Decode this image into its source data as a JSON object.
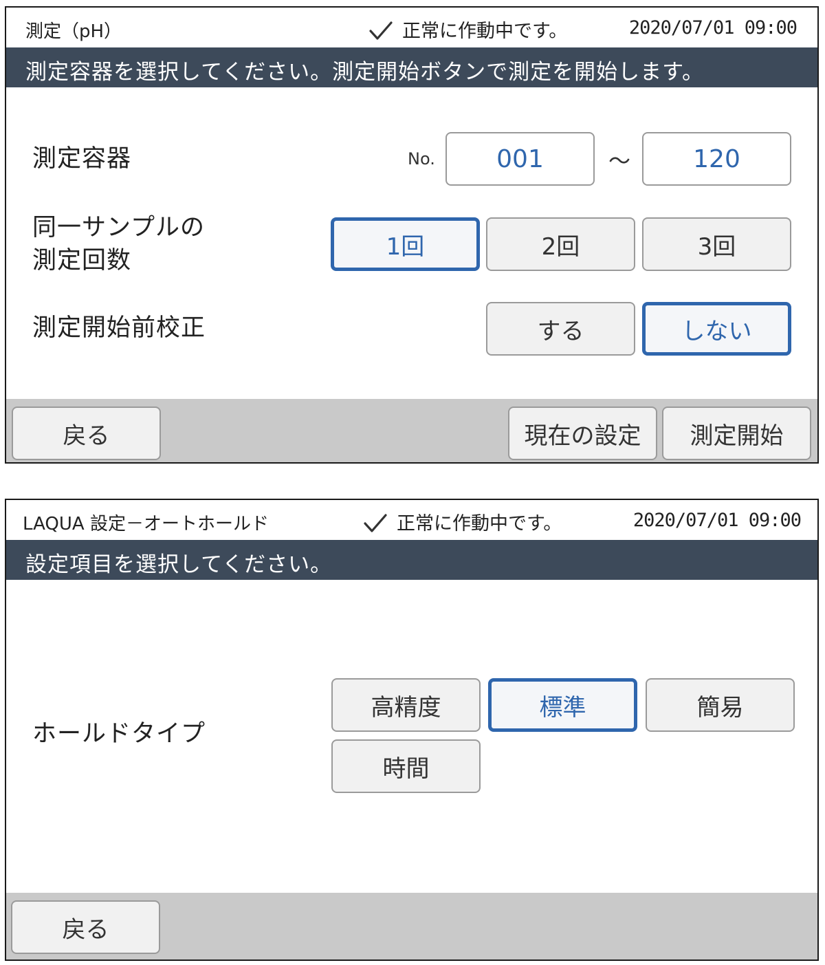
{
  "screen1": {
    "header": {
      "title": "測定（pH）",
      "status_text": "正常に作動中です。",
      "datetime": "2020/07/01 09:00"
    },
    "instruction": "測定容器を選択してください。測定開始ボタンで測定を開始します。",
    "container": {
      "label": "測定容器",
      "no_label": "No.",
      "from_value": "001",
      "tilde": "～",
      "to_value": "120"
    },
    "repeat": {
      "label_line1": "同一サンプルの",
      "label_line2": "測定回数",
      "options": [
        "1回",
        "2回",
        "3回"
      ],
      "selected": "1回"
    },
    "calibration": {
      "label": "測定開始前校正",
      "options": [
        "する",
        "しない"
      ],
      "selected": "しない"
    },
    "footer": {
      "back": "戻る",
      "current_settings": "現在の設定",
      "start": "測定開始"
    }
  },
  "screen2": {
    "header": {
      "title": "LAQUA 設定－オートホールド",
      "status_text": "正常に作動中です。",
      "datetime": "2020/07/01 09:00"
    },
    "instruction": "設定項目を選択してください。",
    "hold_type": {
      "label": "ホールドタイプ",
      "options": [
        "高精度",
        "標準",
        "簡易",
        "時間"
      ],
      "selected": "標準"
    },
    "footer": {
      "back": "戻る"
    }
  },
  "colors": {
    "instruction_bar": "#3d4a5a",
    "accent_blue": "#2f66ad",
    "footer_gray": "#c9c9c9"
  },
  "icons": {
    "status": "checkmark-icon"
  }
}
